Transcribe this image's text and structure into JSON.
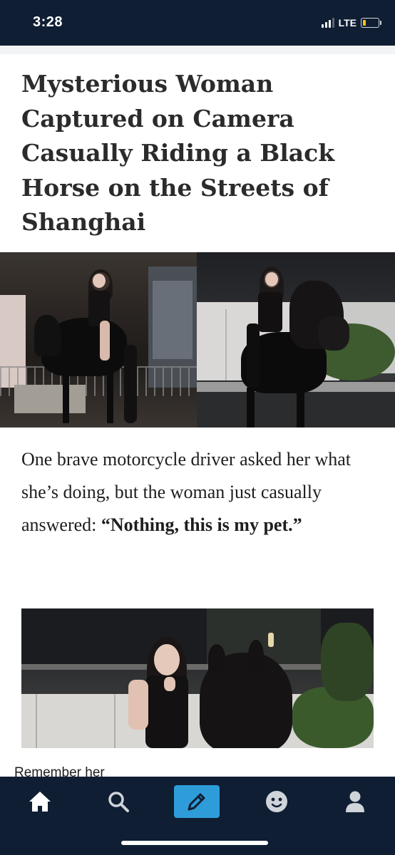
{
  "status_bar": {
    "time": "3:28",
    "network": "LTE",
    "battery_level": 0.2,
    "battery_color": "#f5c518"
  },
  "article": {
    "headline": "Mysterious Woman Captured on Camera Casually Riding a Black Horse on the Streets of Shanghai",
    "paragraph_plain": "One brave motorcycle driver asked her what she’s doing, but the woman just casually answered: ",
    "paragraph_bold": "“Nothing, this is my pet.”",
    "caption": "Remember her"
  },
  "bottom_nav": {
    "items": [
      {
        "icon": "home-icon",
        "active": true
      },
      {
        "icon": "search-icon",
        "active": false
      },
      {
        "icon": "compose-icon",
        "active": false,
        "highlight": "#2e9cd9"
      },
      {
        "icon": "emoji-face-icon",
        "active": false
      },
      {
        "icon": "profile-icon",
        "active": false
      }
    ]
  },
  "colors": {
    "chrome_background": "#0f1e33",
    "accent": "#2e9cd9",
    "headline_text": "#2b2b2b"
  }
}
